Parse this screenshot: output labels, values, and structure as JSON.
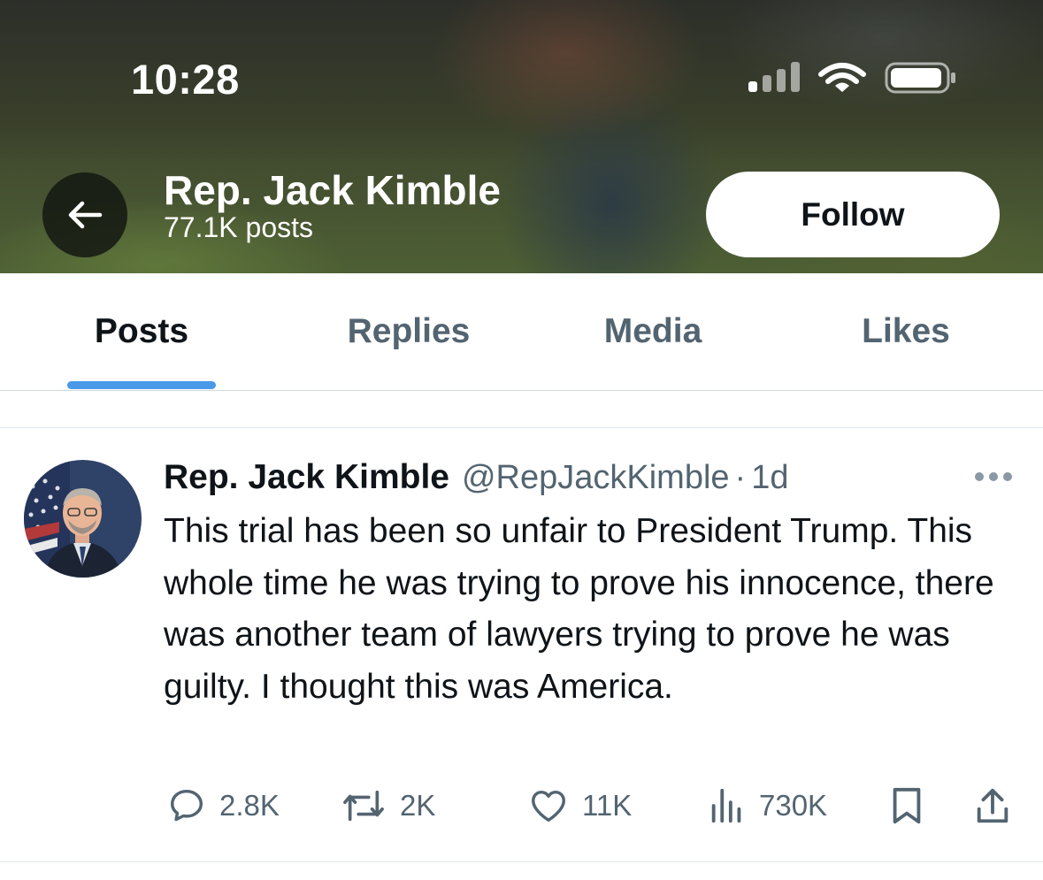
{
  "status_bar": {
    "time": "10:28"
  },
  "header": {
    "name": "Rep. Jack Kimble",
    "post_count": "77.1K posts",
    "follow_label": "Follow"
  },
  "tabs": [
    {
      "label": "Posts",
      "active": true
    },
    {
      "label": "Replies",
      "active": false
    },
    {
      "label": "Media",
      "active": false
    },
    {
      "label": "Likes",
      "active": false
    }
  ],
  "tweet": {
    "author_name": "Rep. Jack Kimble",
    "handle": "@RepJackKimble",
    "separator": "·",
    "time": "1d",
    "text": "This trial has been so unfair to President Trump. This whole time he was trying to prove his innocence, there was another team of lawyers trying to prove he was guilty. I thought this was America.",
    "actions": {
      "replies": "2.8K",
      "reposts": "2K",
      "likes": "11K",
      "views": "730K"
    }
  },
  "colors": {
    "text_primary": "#0f1419",
    "text_secondary": "#536471",
    "tab_indicator": "#4a99e9"
  },
  "icons": [
    "arrow-left-icon",
    "signal-icon",
    "wifi-icon",
    "battery-icon",
    "more-icon",
    "reply-icon",
    "repost-icon",
    "like-icon",
    "views-icon",
    "bookmark-icon",
    "share-icon"
  ]
}
